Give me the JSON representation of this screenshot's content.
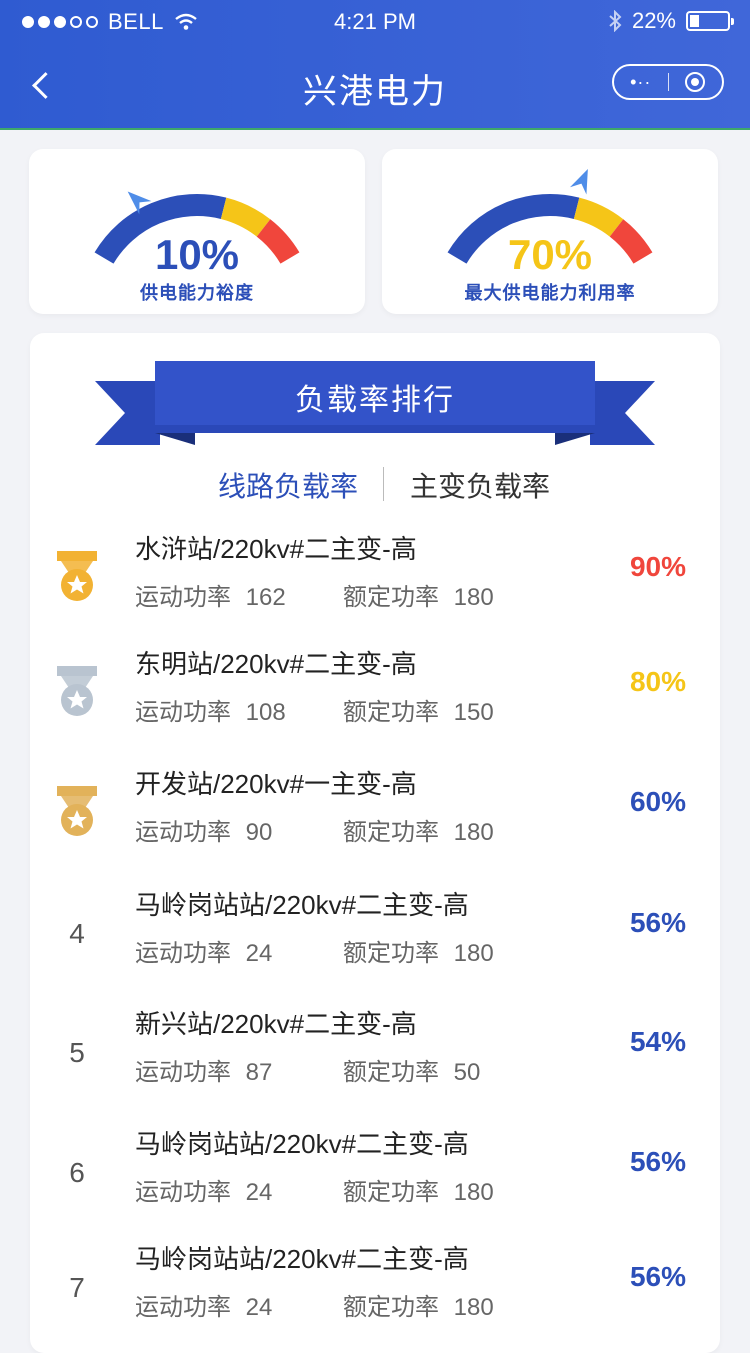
{
  "status": {
    "carrier": "BELL",
    "time": "4:21 PM",
    "battery": "22%"
  },
  "nav": {
    "title": "兴港电力",
    "more": "•··"
  },
  "colors": {
    "blue": "#2c4fb8",
    "yellow": "#f5c518",
    "red": "#f0463c",
    "gold": "#f2b233",
    "silver": "#b9c4d0",
    "bronze": "#e2b25a"
  },
  "gauges": [
    {
      "value": "10%",
      "label": "供电能力裕度",
      "color": "#2c4fb8",
      "level": 0.1
    },
    {
      "value": "70%",
      "label": "最大供电能力利用率",
      "color": "#f5c518",
      "level": 0.7
    }
  ],
  "ranking": {
    "title": "负载率排行",
    "tabs": [
      "线路负载率",
      "主变负载率"
    ],
    "rows": [
      {
        "rank": "1",
        "medal": "gold",
        "name": "水浒站/220kv#二主变-高",
        "run_label": "运动功率",
        "run": "162",
        "rated_label": "额定功率",
        "rated": "180",
        "pct": "90%",
        "color": "#f0463c"
      },
      {
        "rank": "2",
        "medal": "silver",
        "name": "东明站/220kv#二主变-高",
        "run_label": "运动功率",
        "run": "108",
        "rated_label": "额定功率",
        "rated": "150",
        "pct": "80%",
        "color": "#f5c518"
      },
      {
        "rank": "3",
        "medal": "bronze",
        "name": "开发站/220kv#一主变-高",
        "run_label": "运动功率",
        "run": "90",
        "rated_label": "额定功率",
        "rated": "180",
        "pct": "60%",
        "color": "#2c4fb8"
      },
      {
        "rank": "4",
        "medal": "",
        "name": "马岭岗站站/220kv#二主变-高",
        "run_label": "运动功率",
        "run": "24",
        "rated_label": "额定功率",
        "rated": "180",
        "pct": "56%",
        "color": "#2c4fb8"
      },
      {
        "rank": "5",
        "medal": "",
        "name": "新兴站/220kv#二主变-高",
        "run_label": "运动功率",
        "run": "87",
        "rated_label": "额定功率",
        "rated": "50",
        "pct": "54%",
        "color": "#2c4fb8"
      },
      {
        "rank": "6",
        "medal": "",
        "name": "马岭岗站站/220kv#二主变-高",
        "run_label": "运动功率",
        "run": "24",
        "rated_label": "额定功率",
        "rated": "180",
        "pct": "56%",
        "color": "#2c4fb8"
      },
      {
        "rank": "7",
        "medal": "",
        "name": "马岭岗站站/220kv#二主变-高",
        "run_label": "运动功率",
        "run": "24",
        "rated_label": "额定功率",
        "rated": "180",
        "pct": "56%",
        "color": "#2c4fb8"
      }
    ]
  }
}
